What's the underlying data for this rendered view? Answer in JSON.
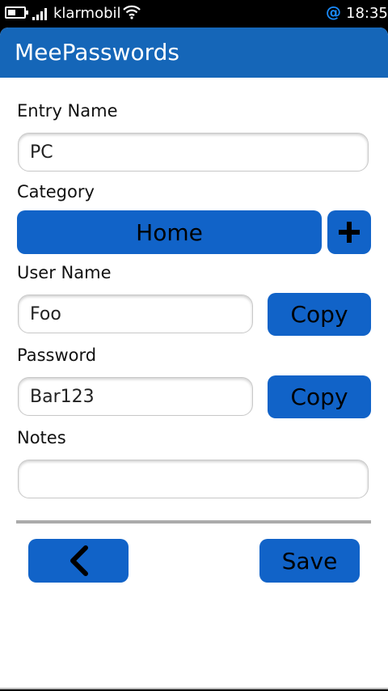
{
  "status_bar": {
    "carrier": "klarmobil",
    "time": "18:35",
    "notification": "@",
    "icons": [
      "battery-icon",
      "signal-icon",
      "wifi-icon"
    ]
  },
  "header": {
    "title": "MeePasswords"
  },
  "form": {
    "entry_name": {
      "label": "Entry Name",
      "value": "PC"
    },
    "category": {
      "label": "Category",
      "value": "Home",
      "add_icon": "plus-icon"
    },
    "user_name": {
      "label": "User Name",
      "value": "Foo",
      "copy_label": "Copy"
    },
    "password": {
      "label": "Password",
      "value": "Bar123",
      "copy_label": "Copy"
    },
    "notes": {
      "label": "Notes",
      "value": ""
    }
  },
  "actions": {
    "back_icon": "back-arrow-icon",
    "save_label": "Save"
  },
  "colors": {
    "accent": "#1163c8",
    "header": "#1566b8"
  }
}
